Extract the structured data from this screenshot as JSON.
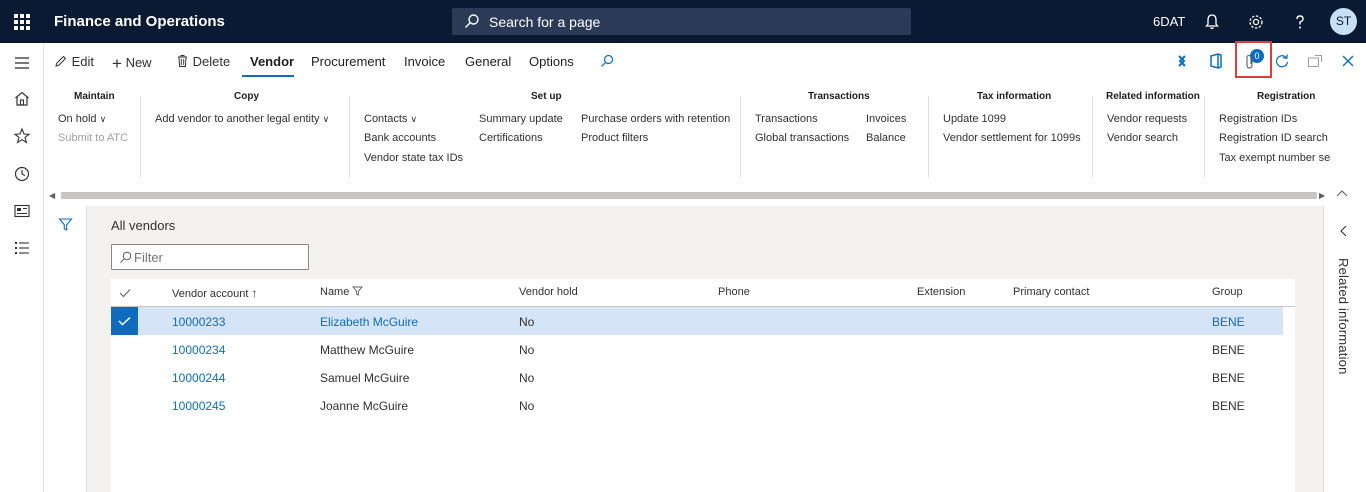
{
  "header": {
    "app_title": "Finance and Operations",
    "search_placeholder": "Search for a page",
    "company": "6DAT",
    "user_initials": "ST"
  },
  "action_pane": {
    "edit": "Edit",
    "new": "New",
    "delete": "Delete",
    "tabs": [
      "Vendor",
      "Procurement",
      "Invoice",
      "General",
      "Options"
    ],
    "active_tab": "Vendor",
    "notification_count": "0"
  },
  "ribbon": {
    "maintain": {
      "title": "Maintain",
      "on_hold": "On hold",
      "submit_atc": "Submit to ATC"
    },
    "copy": {
      "title": "Copy",
      "add_vendor": "Add vendor to another legal entity"
    },
    "setup": {
      "title": "Set up",
      "contacts": "Contacts",
      "bank_accounts": "Bank accounts",
      "vendor_state_tax": "Vendor state tax IDs",
      "summary_update": "Summary update",
      "certifications": "Certifications",
      "po_retention": "Purchase orders with retention",
      "product_filters": "Product filters"
    },
    "transactions": {
      "title": "Transactions",
      "transactions": "Transactions",
      "global_transactions": "Global transactions",
      "invoices": "Invoices",
      "balance": "Balance"
    },
    "tax": {
      "title": "Tax information",
      "update_1099": "Update 1099",
      "vendor_settlement": "Vendor settlement for 1099s"
    },
    "related": {
      "title": "Related information",
      "vendor_requests": "Vendor requests",
      "vendor_search": "Vendor search"
    },
    "registration": {
      "title": "Registration",
      "registration_ids": "Registration IDs",
      "registration_id_search": "Registration ID search",
      "tax_exempt": "Tax exempt number sea"
    }
  },
  "main": {
    "title": "All vendors",
    "filter_placeholder": "Filter",
    "columns": [
      "Vendor account",
      "Name",
      "Vendor hold",
      "Phone",
      "Extension",
      "Primary contact",
      "Group"
    ],
    "rows": [
      {
        "account": "10000233",
        "name": "Elizabeth McGuire",
        "hold": "No",
        "group": "BENE",
        "selected": true
      },
      {
        "account": "10000234",
        "name": "Matthew McGuire",
        "hold": "No",
        "group": "BENE",
        "selected": false
      },
      {
        "account": "10000244",
        "name": "Samuel McGuire",
        "hold": "No",
        "group": "BENE",
        "selected": false
      },
      {
        "account": "10000245",
        "name": "Joanne McGuire",
        "hold": "No",
        "group": "BENE",
        "selected": false
      }
    ]
  },
  "right_pane": {
    "label": "Related information"
  },
  "colors": {
    "topbar": "#0b1a33",
    "accent": "#0f6cbd",
    "selected_row": "#d6e4f7",
    "highlight": "#e03c3c"
  }
}
